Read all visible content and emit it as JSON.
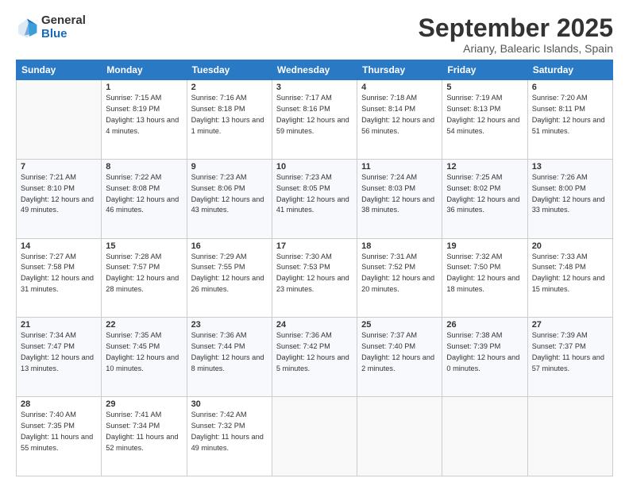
{
  "header": {
    "logo_general": "General",
    "logo_blue": "Blue",
    "title": "September 2025",
    "location": "Ariany, Balearic Islands, Spain"
  },
  "days_header": [
    "Sunday",
    "Monday",
    "Tuesday",
    "Wednesday",
    "Thursday",
    "Friday",
    "Saturday"
  ],
  "weeks": [
    [
      {
        "day": "",
        "sunrise": "",
        "sunset": "",
        "daylight": ""
      },
      {
        "day": "1",
        "sunrise": "Sunrise: 7:15 AM",
        "sunset": "Sunset: 8:19 PM",
        "daylight": "Daylight: 13 hours and 4 minutes."
      },
      {
        "day": "2",
        "sunrise": "Sunrise: 7:16 AM",
        "sunset": "Sunset: 8:18 PM",
        "daylight": "Daylight: 13 hours and 1 minute."
      },
      {
        "day": "3",
        "sunrise": "Sunrise: 7:17 AM",
        "sunset": "Sunset: 8:16 PM",
        "daylight": "Daylight: 12 hours and 59 minutes."
      },
      {
        "day": "4",
        "sunrise": "Sunrise: 7:18 AM",
        "sunset": "Sunset: 8:14 PM",
        "daylight": "Daylight: 12 hours and 56 minutes."
      },
      {
        "day": "5",
        "sunrise": "Sunrise: 7:19 AM",
        "sunset": "Sunset: 8:13 PM",
        "daylight": "Daylight: 12 hours and 54 minutes."
      },
      {
        "day": "6",
        "sunrise": "Sunrise: 7:20 AM",
        "sunset": "Sunset: 8:11 PM",
        "daylight": "Daylight: 12 hours and 51 minutes."
      }
    ],
    [
      {
        "day": "7",
        "sunrise": "Sunrise: 7:21 AM",
        "sunset": "Sunset: 8:10 PM",
        "daylight": "Daylight: 12 hours and 49 minutes."
      },
      {
        "day": "8",
        "sunrise": "Sunrise: 7:22 AM",
        "sunset": "Sunset: 8:08 PM",
        "daylight": "Daylight: 12 hours and 46 minutes."
      },
      {
        "day": "9",
        "sunrise": "Sunrise: 7:23 AM",
        "sunset": "Sunset: 8:06 PM",
        "daylight": "Daylight: 12 hours and 43 minutes."
      },
      {
        "day": "10",
        "sunrise": "Sunrise: 7:23 AM",
        "sunset": "Sunset: 8:05 PM",
        "daylight": "Daylight: 12 hours and 41 minutes."
      },
      {
        "day": "11",
        "sunrise": "Sunrise: 7:24 AM",
        "sunset": "Sunset: 8:03 PM",
        "daylight": "Daylight: 12 hours and 38 minutes."
      },
      {
        "day": "12",
        "sunrise": "Sunrise: 7:25 AM",
        "sunset": "Sunset: 8:02 PM",
        "daylight": "Daylight: 12 hours and 36 minutes."
      },
      {
        "day": "13",
        "sunrise": "Sunrise: 7:26 AM",
        "sunset": "Sunset: 8:00 PM",
        "daylight": "Daylight: 12 hours and 33 minutes."
      }
    ],
    [
      {
        "day": "14",
        "sunrise": "Sunrise: 7:27 AM",
        "sunset": "Sunset: 7:58 PM",
        "daylight": "Daylight: 12 hours and 31 minutes."
      },
      {
        "day": "15",
        "sunrise": "Sunrise: 7:28 AM",
        "sunset": "Sunset: 7:57 PM",
        "daylight": "Daylight: 12 hours and 28 minutes."
      },
      {
        "day": "16",
        "sunrise": "Sunrise: 7:29 AM",
        "sunset": "Sunset: 7:55 PM",
        "daylight": "Daylight: 12 hours and 26 minutes."
      },
      {
        "day": "17",
        "sunrise": "Sunrise: 7:30 AM",
        "sunset": "Sunset: 7:53 PM",
        "daylight": "Daylight: 12 hours and 23 minutes."
      },
      {
        "day": "18",
        "sunrise": "Sunrise: 7:31 AM",
        "sunset": "Sunset: 7:52 PM",
        "daylight": "Daylight: 12 hours and 20 minutes."
      },
      {
        "day": "19",
        "sunrise": "Sunrise: 7:32 AM",
        "sunset": "Sunset: 7:50 PM",
        "daylight": "Daylight: 12 hours and 18 minutes."
      },
      {
        "day": "20",
        "sunrise": "Sunrise: 7:33 AM",
        "sunset": "Sunset: 7:48 PM",
        "daylight": "Daylight: 12 hours and 15 minutes."
      }
    ],
    [
      {
        "day": "21",
        "sunrise": "Sunrise: 7:34 AM",
        "sunset": "Sunset: 7:47 PM",
        "daylight": "Daylight: 12 hours and 13 minutes."
      },
      {
        "day": "22",
        "sunrise": "Sunrise: 7:35 AM",
        "sunset": "Sunset: 7:45 PM",
        "daylight": "Daylight: 12 hours and 10 minutes."
      },
      {
        "day": "23",
        "sunrise": "Sunrise: 7:36 AM",
        "sunset": "Sunset: 7:44 PM",
        "daylight": "Daylight: 12 hours and 8 minutes."
      },
      {
        "day": "24",
        "sunrise": "Sunrise: 7:36 AM",
        "sunset": "Sunset: 7:42 PM",
        "daylight": "Daylight: 12 hours and 5 minutes."
      },
      {
        "day": "25",
        "sunrise": "Sunrise: 7:37 AM",
        "sunset": "Sunset: 7:40 PM",
        "daylight": "Daylight: 12 hours and 2 minutes."
      },
      {
        "day": "26",
        "sunrise": "Sunrise: 7:38 AM",
        "sunset": "Sunset: 7:39 PM",
        "daylight": "Daylight: 12 hours and 0 minutes."
      },
      {
        "day": "27",
        "sunrise": "Sunrise: 7:39 AM",
        "sunset": "Sunset: 7:37 PM",
        "daylight": "Daylight: 11 hours and 57 minutes."
      }
    ],
    [
      {
        "day": "28",
        "sunrise": "Sunrise: 7:40 AM",
        "sunset": "Sunset: 7:35 PM",
        "daylight": "Daylight: 11 hours and 55 minutes."
      },
      {
        "day": "29",
        "sunrise": "Sunrise: 7:41 AM",
        "sunset": "Sunset: 7:34 PM",
        "daylight": "Daylight: 11 hours and 52 minutes."
      },
      {
        "day": "30",
        "sunrise": "Sunrise: 7:42 AM",
        "sunset": "Sunset: 7:32 PM",
        "daylight": "Daylight: 11 hours and 49 minutes."
      },
      {
        "day": "",
        "sunrise": "",
        "sunset": "",
        "daylight": ""
      },
      {
        "day": "",
        "sunrise": "",
        "sunset": "",
        "daylight": ""
      },
      {
        "day": "",
        "sunrise": "",
        "sunset": "",
        "daylight": ""
      },
      {
        "day": "",
        "sunrise": "",
        "sunset": "",
        "daylight": ""
      }
    ]
  ]
}
